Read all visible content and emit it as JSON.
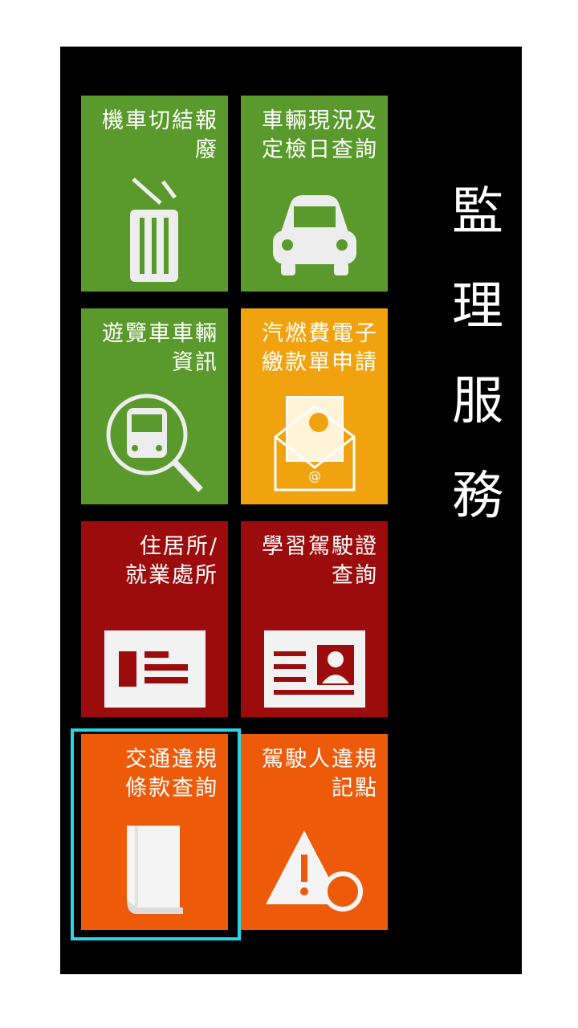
{
  "section_title": [
    "監",
    "理",
    "服",
    "務"
  ],
  "tiles": [
    {
      "label": "機車切結報廢",
      "icon": "trash-can-icon",
      "color": "#5a9a2c"
    },
    {
      "label": "車輛現況及\n定檢日查詢",
      "icon": "car-icon",
      "color": "#5a9a2c"
    },
    {
      "label": "遊覽車車輛\n資訊",
      "icon": "bus-search-icon",
      "color": "#5a9a2c"
    },
    {
      "label": "汽燃費電子\n繳款單申請",
      "icon": "mail-envelope-icon",
      "color": "#f1a30f"
    },
    {
      "label": "住居所/\n就業處所",
      "icon": "id-card-icon",
      "color": "#9c0c0c"
    },
    {
      "label": "學習駕駛證\n查詢",
      "icon": "license-card-icon",
      "color": "#9c0c0c"
    },
    {
      "label": "交通違規\n條款查詢",
      "icon": "book-icon",
      "color": "#ec5a0a",
      "selected": true
    },
    {
      "label": "駕駛人違規\n記點",
      "icon": "warning-search-icon",
      "color": "#ec5a0a"
    }
  ]
}
